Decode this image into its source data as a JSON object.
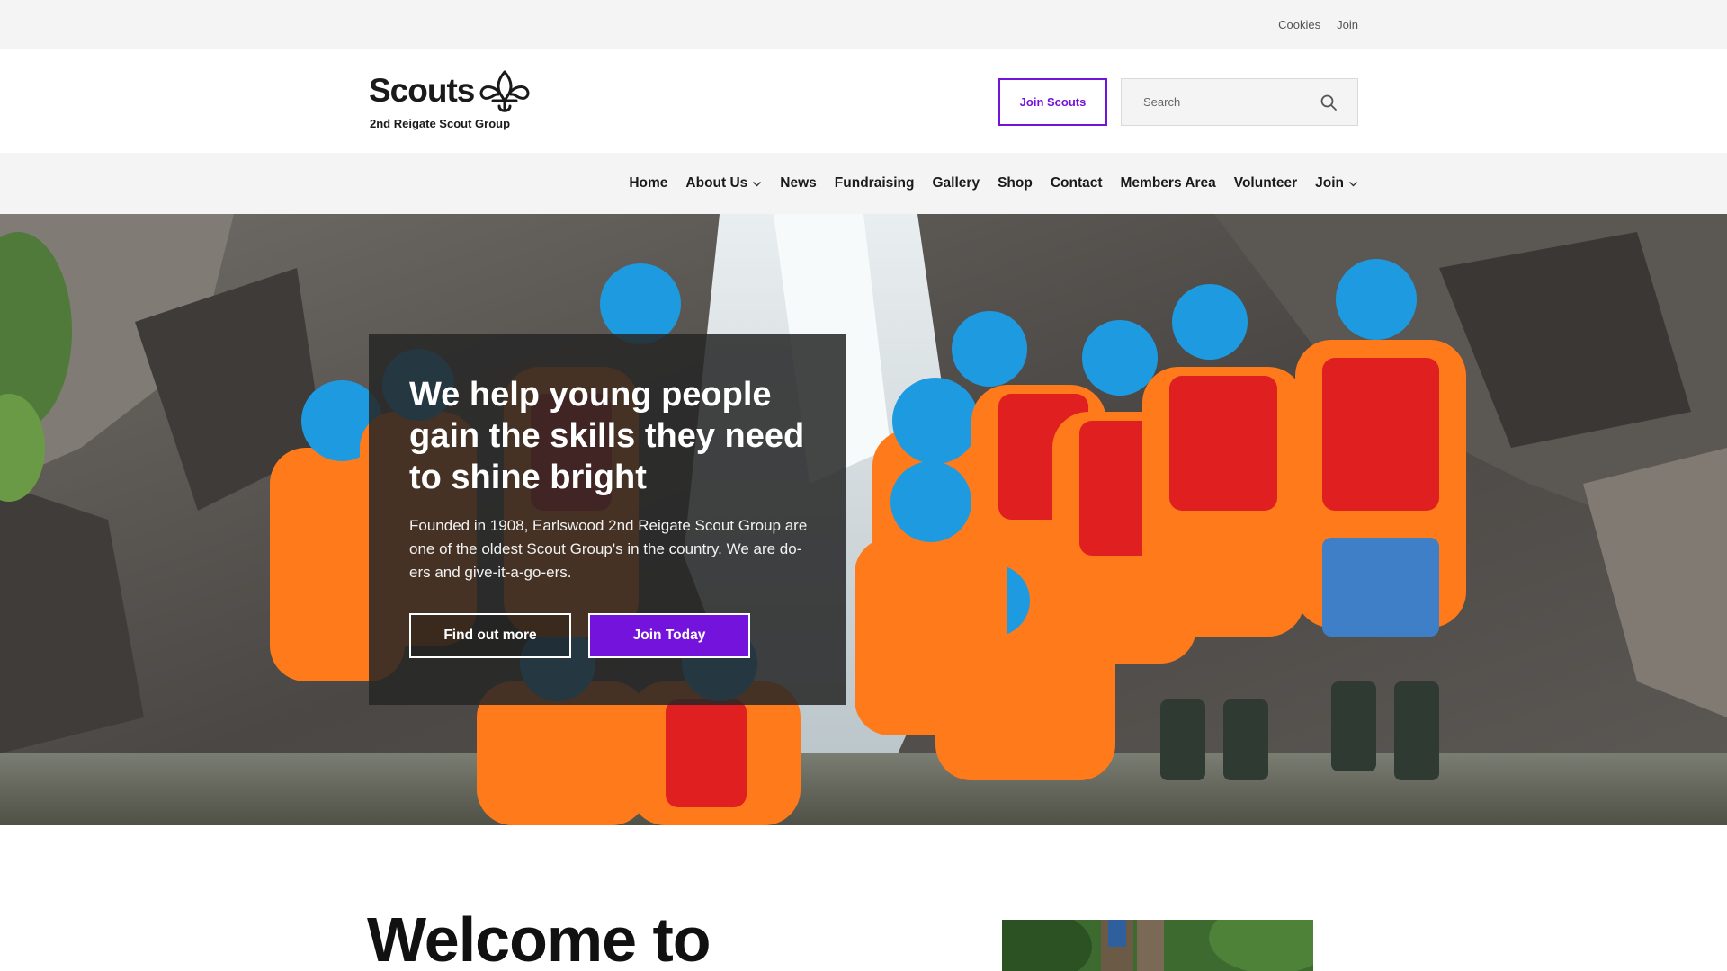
{
  "utility_bar": {
    "links": [
      "Cookies",
      "Join"
    ]
  },
  "header": {
    "logo_word": "Scouts",
    "logo_sub": "2nd Reigate Scout Group",
    "join_button": "Join Scouts",
    "search_placeholder": "Search"
  },
  "nav": {
    "items": [
      {
        "label": "Home",
        "has_dropdown": false
      },
      {
        "label": "About Us",
        "has_dropdown": true
      },
      {
        "label": "News",
        "has_dropdown": false
      },
      {
        "label": "Fundraising",
        "has_dropdown": false
      },
      {
        "label": "Gallery",
        "has_dropdown": false
      },
      {
        "label": "Shop",
        "has_dropdown": false
      },
      {
        "label": "Contact",
        "has_dropdown": false
      },
      {
        "label": "Members Area",
        "has_dropdown": false
      },
      {
        "label": "Volunteer",
        "has_dropdown": false
      },
      {
        "label": "Join",
        "has_dropdown": true
      }
    ]
  },
  "hero": {
    "title": "We help young people gain the skills they need to shine bright",
    "text": "Founded in 1908, Earlswood 2nd Reigate Scout Group are one of the oldest Scout Group's in the country. We are do-ers and give-it-a-go-ers.",
    "primary_button": "Find out more",
    "secondary_button": "Join Today"
  },
  "welcome": {
    "heading": "Welcome to"
  },
  "colors": {
    "brand_purple": "#7413dc",
    "utility_bg": "#f4f4f4",
    "card_bg": "#262626",
    "helmet_blue": "#1e9be0",
    "drysuit_orange": "#ff7a1a",
    "buoyancy_red": "#e02020"
  },
  "icons": [
    "fleur-de-lis-icon",
    "search-icon",
    "chevron-down-icon"
  ]
}
